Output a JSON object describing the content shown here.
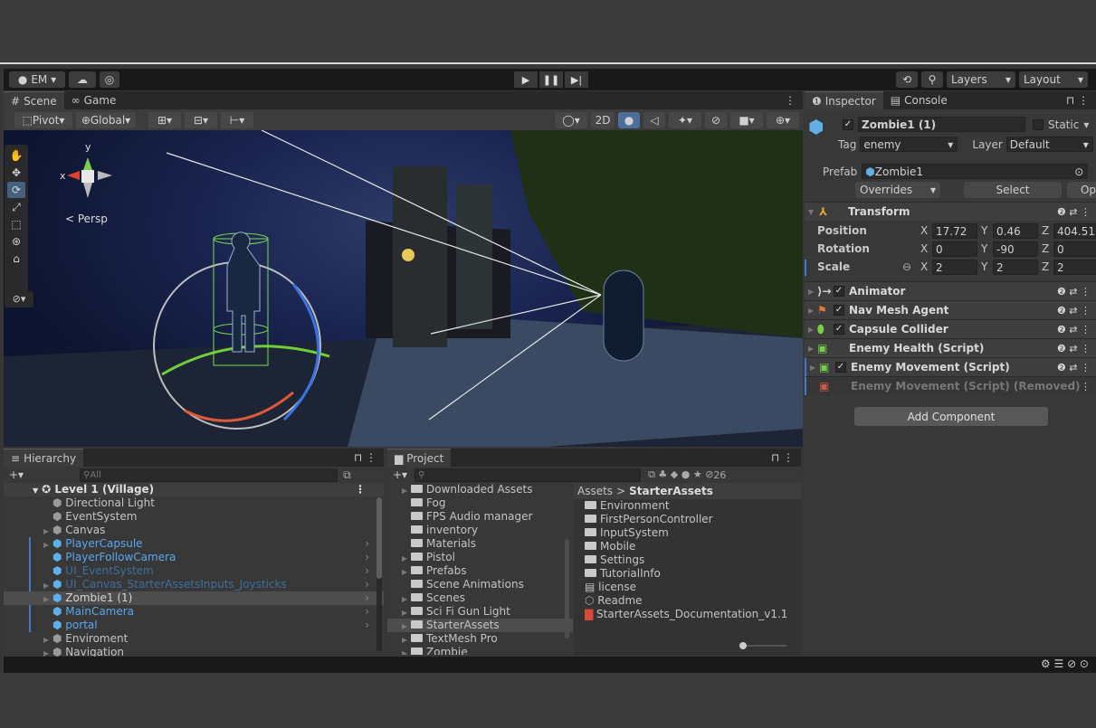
{
  "toolbar": {
    "account": "EM ▾",
    "layers": "Layers",
    "layout": "Layout"
  },
  "tabs": {
    "scene": "Scene",
    "game": "Game",
    "inspector": "Inspector",
    "console": "Console",
    "hierarchy": "Hierarchy",
    "project": "Project"
  },
  "scene_toolbar": {
    "pivot": "Pivot",
    "global": "Global",
    "mode2d": "2D",
    "persp": "< Persp"
  },
  "hierarchy": {
    "search_placeholder": "All",
    "scene_name": "Level 1 (Village)",
    "items": [
      {
        "label": "Directional Light",
        "color": "#c4c4c4",
        "indent": 1,
        "arrow": false
      },
      {
        "label": "EventSystem",
        "color": "#c4c4c4",
        "indent": 1,
        "arrow": false
      },
      {
        "label": "Canvas",
        "color": "#c4c4c4",
        "indent": 1,
        "arrow": true
      },
      {
        "label": "PlayerCapsule",
        "color": "#5aa6ef",
        "indent": 1,
        "arrow": true
      },
      {
        "label": "PlayerFollowCamera",
        "color": "#5aa6ef",
        "indent": 1,
        "arrow": false
      },
      {
        "label": "UI_EventSystem",
        "color": "#3f6e9e",
        "indent": 1,
        "arrow": false
      },
      {
        "label": "UI_Canvas_StarterAssetsInputs_Joysticks",
        "color": "#3f6e9e",
        "indent": 1,
        "arrow": true
      },
      {
        "label": "Zombie1 (1)",
        "color": "#d6d6d6",
        "indent": 1,
        "arrow": true
      },
      {
        "label": "MainCamera",
        "color": "#5aa6ef",
        "indent": 1,
        "arrow": false
      },
      {
        "label": "portal",
        "color": "#5aa6ef",
        "indent": 1,
        "arrow": false
      },
      {
        "label": "Enviroment",
        "color": "#c4c4c4",
        "indent": 1,
        "arrow": true
      },
      {
        "label": "Navigation",
        "color": "#c4c4c4",
        "indent": 1,
        "arrow": true
      }
    ]
  },
  "project": {
    "count": "26",
    "breadcrumb_root": "Assets",
    "breadcrumb_leaf": "StarterAssets",
    "folders": [
      "Downloaded Assets",
      "Fog",
      "FPS Audio manager",
      "inventory",
      "Materials",
      "Pistol",
      "Prefabs",
      "Scene Animations",
      "Scenes",
      "Sci Fi Gun Light",
      "StarterAssets",
      "TextMesh Pro",
      "Zombie"
    ],
    "assets": [
      "Environment",
      "FirstPersonController",
      "InputSystem",
      "Mobile",
      "Settings",
      "TutorialInfo",
      "license",
      "Readme",
      "StarterAssets_Documentation_v1.1"
    ]
  },
  "inspector": {
    "object_name": "Zombie1 (1)",
    "static_label": "Static",
    "tag_label": "Tag",
    "tag_value": "enemy",
    "layer_label": "Layer",
    "layer_value": "Default",
    "prefab_label": "Prefab",
    "prefab_value": "Zombie1",
    "overrides": "Overrides",
    "select": "Select",
    "open": "Open",
    "transform": "Transform",
    "position_label": "Position",
    "rotation_label": "Rotation",
    "scale_label": "Scale",
    "position": {
      "x": "17.72",
      "y": "0.46",
      "z": "404.51"
    },
    "rotation": {
      "x": "0",
      "y": "-90",
      "z": "0"
    },
    "scale": {
      "x": "2",
      "y": "2",
      "z": "2"
    },
    "components": [
      "Animator",
      "Nav Mesh Agent",
      "Capsule Collider",
      "Enemy Health (Script)",
      "Enemy Movement (Script)",
      "Enemy Movement (Script) (Removed)"
    ],
    "add_component": "Add Component"
  },
  "axes": {
    "x": "x",
    "y": "y",
    "X": "X",
    "Y": "Y",
    "Z": "Z"
  }
}
